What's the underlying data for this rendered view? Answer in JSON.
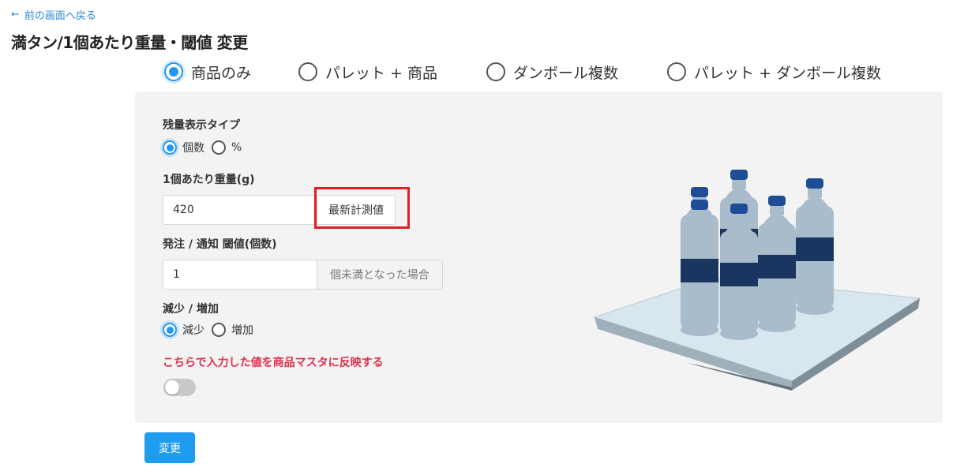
{
  "nav": {
    "back_icon": "arrow-left-icon",
    "back_label": "前の画面へ戻る"
  },
  "page": {
    "title": "満タン/1個あたり重量・閾値 変更"
  },
  "mode": {
    "selected": "商品のみ",
    "options": [
      "商品のみ",
      "パレット + 商品",
      "ダンボール複数",
      "パレット + ダンボール複数"
    ]
  },
  "form": {
    "display_type": {
      "label": "残量表示タイプ",
      "selected": "個数",
      "options": [
        "個数",
        "%"
      ]
    },
    "unit_weight": {
      "label": "1個あたり重量(g)",
      "value": "420",
      "button_label": "最新計測値"
    },
    "threshold": {
      "label": "発注 / 通知 閾値(個数)",
      "value": "1",
      "suffix": "個未満となった場合"
    },
    "direction": {
      "label": "減少 / 増加",
      "selected": "減少",
      "options": [
        "減少",
        "増加"
      ]
    },
    "reflect": {
      "label": "こちらで入力した値を商品マスタに反映する",
      "enabled": false
    }
  },
  "actions": {
    "submit_label": "変更"
  },
  "colors": {
    "accent": "#2196f3",
    "primary_button": "#1e9cf0",
    "warning_text": "#e0314b",
    "highlight_border": "#e02020",
    "panel_background": "#f3f3f3",
    "bottle_body": "#a9bccb",
    "bottle_label": "#1b3561",
    "bottle_cap": "#1e4d96",
    "scale_top": "#d8e6ee"
  }
}
